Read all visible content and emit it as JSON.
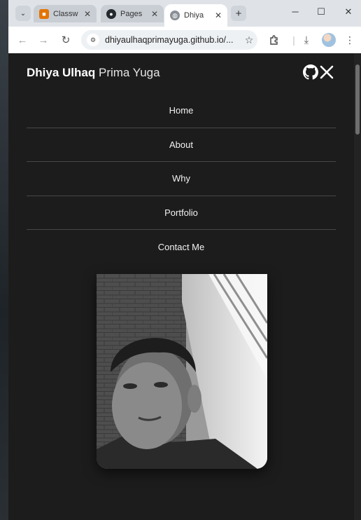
{
  "browser": {
    "tabs": [
      {
        "title": "Classw",
        "icon": "classroom-icon",
        "color": "#e37400"
      },
      {
        "title": "Pages",
        "icon": "github-icon",
        "color": "#24292e"
      },
      {
        "title": "Dhiya",
        "icon": "globe-icon",
        "color": "#5f6368",
        "active": true
      }
    ],
    "url": "dhiyaulhaqprimayuga.github.io/..."
  },
  "site": {
    "brand_bold": "Dhiya Ulhaq",
    "brand_light": "Prima Yuga",
    "nav": [
      "Home",
      "About",
      "Why",
      "Portfolio",
      "Contact Me"
    ],
    "colors": {
      "background": "#1c1c1c",
      "text": "#ffffff",
      "divider": "#474747"
    }
  }
}
